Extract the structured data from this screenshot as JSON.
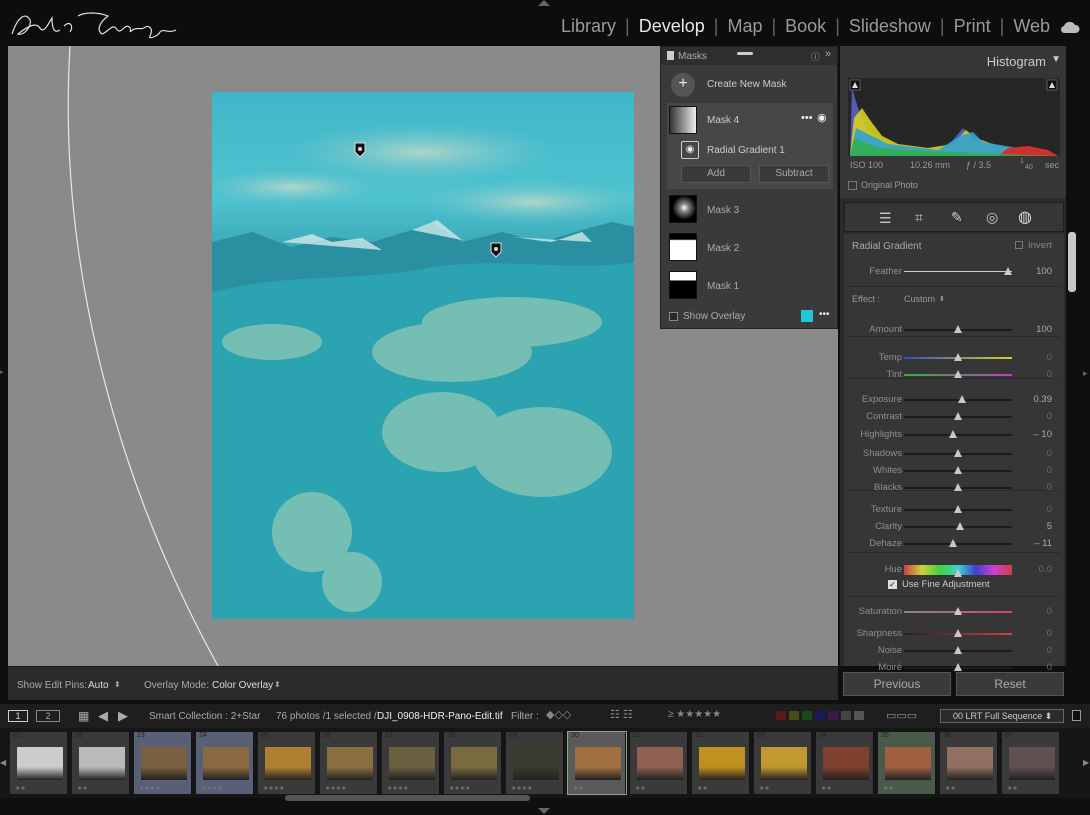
{
  "modules": {
    "items": [
      "Library",
      "Develop",
      "Map",
      "Book",
      "Slideshow",
      "Print",
      "Web"
    ],
    "active": "Develop"
  },
  "masks": {
    "title": "Masks",
    "create_label": "Create New Mask",
    "items": [
      {
        "name": "Mask 4",
        "selected": true
      },
      {
        "name": "Mask 3"
      },
      {
        "name": "Mask 2"
      },
      {
        "name": "Mask 1"
      }
    ],
    "component": "Radial Gradient 1",
    "add_label": "Add",
    "subtract_label": "Subtract",
    "show_overlay": "Show Overlay",
    "overlay_color": "#1ec8d4"
  },
  "histogram": {
    "title": "Histogram",
    "iso": "ISO 100",
    "focal": "10.26 mm",
    "aperture": "ƒ / 3.5",
    "shutter_num": "1",
    "shutter_den": "40",
    "shutter_unit": "sec",
    "original_photo": "Original Photo"
  },
  "radial": {
    "title": "Radial Gradient",
    "invert": "Invert",
    "feather": {
      "label": "Feather",
      "value": "100",
      "pos": 0.96
    },
    "effect_label": "Effect :",
    "effect_value": "Custom",
    "sliders": [
      {
        "label": "Amount",
        "value": "100",
        "pos": 0.5
      },
      {
        "label": "Temp",
        "value": "0",
        "pos": 0.5
      },
      {
        "label": "Tint",
        "value": "0",
        "pos": 0.5
      },
      {
        "label": "Exposure",
        "value": "0.39",
        "pos": 0.54
      },
      {
        "label": "Contrast",
        "value": "0",
        "pos": 0.5
      },
      {
        "label": "Highlights",
        "value": "– 10",
        "pos": 0.45
      },
      {
        "label": "Shadows",
        "value": "0",
        "pos": 0.5
      },
      {
        "label": "Whites",
        "value": "0",
        "pos": 0.5
      },
      {
        "label": "Blacks",
        "value": "0",
        "pos": 0.5
      },
      {
        "label": "Texture",
        "value": "0",
        "pos": 0.5
      },
      {
        "label": "Clarity",
        "value": "5",
        "pos": 0.52
      },
      {
        "label": "Dehaze",
        "value": "– 11",
        "pos": 0.45
      },
      {
        "label": "Hue",
        "value": "0.0",
        "pos": 0.5
      },
      {
        "label": "Saturation",
        "value": "0",
        "pos": 0.5
      },
      {
        "label": "Sharpness",
        "value": "0",
        "pos": 0.5
      },
      {
        "label": "Noise",
        "value": "0",
        "pos": 0.5
      },
      {
        "label": "Moiré",
        "value": "0",
        "pos": 0.5
      }
    ],
    "fine_adjust": "Use Fine Adjustment"
  },
  "buttons": {
    "previous": "Previous",
    "reset": "Reset"
  },
  "toolbar": {
    "edit_pins_label": "Show Edit Pins:",
    "edit_pins_value": "Auto",
    "overlay_label": "Overlay Mode:",
    "overlay_value": "Color Overlay"
  },
  "filmstrip_bar": {
    "view1": "1",
    "view2": "2",
    "collection": "Smart Collection : 2+Star",
    "count": "76 photos /1 selected /",
    "filename": "DJI_0908-HDR-Pano-Edit.tif",
    "filter": "Filter :",
    "preset": "00 LRT Full Sequence"
  },
  "filmstrip": [
    {
      "num": "21",
      "stars": "★★",
      "bg": "#ccc"
    },
    {
      "num": "23",
      "stars": "★★",
      "bg": "#bbb"
    },
    {
      "num": "23",
      "stars": "★★★★",
      "bg": "#7a6040"
    },
    {
      "num": "24",
      "stars": "★★★★",
      "bg": "#8a6a40"
    },
    {
      "num": "25",
      "stars": "★★★★",
      "bg": "#b08030"
    },
    {
      "num": "26",
      "stars": "★★★★",
      "bg": "#8a7040"
    },
    {
      "num": "27",
      "stars": "★★★★",
      "bg": "#6a6040"
    },
    {
      "num": "28",
      "stars": "★★★★",
      "bg": "#7a6a40"
    },
    {
      "num": "29",
      "stars": "★★★★",
      "bg": "#3a3a30"
    },
    {
      "num": "30",
      "stars": "★★",
      "bg": "#a07040"
    },
    {
      "num": "31",
      "stars": "★★",
      "bg": "#906050"
    },
    {
      "num": "32",
      "stars": "★★",
      "bg": "#c09020"
    },
    {
      "num": "33",
      "stars": "★★",
      "bg": "#c09a30"
    },
    {
      "num": "34",
      "stars": "★★",
      "bg": "#804030"
    },
    {
      "num": "35",
      "stars": "★★",
      "bg": "#a06040"
    },
    {
      "num": "36",
      "stars": "★★",
      "bg": "#907060"
    },
    {
      "num": "37",
      "stars": "★★",
      "bg": "#605050"
    }
  ]
}
